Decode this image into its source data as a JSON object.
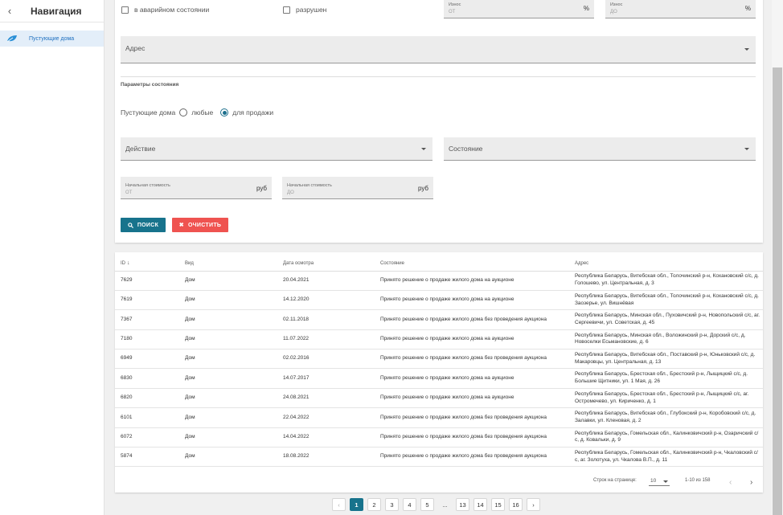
{
  "sidebar": {
    "title": "Навигация",
    "back_icon": "chevron-left-icon",
    "items": [
      {
        "label": "Пустующие дома",
        "icon": "leaf-icon"
      }
    ]
  },
  "filters": {
    "cb_emergency": "в аварийном состоянии",
    "cb_destroyed": "разрушен",
    "wear_from": {
      "label": "Износ",
      "placeholder": "ОТ",
      "suffix": "%"
    },
    "wear_to": {
      "label": "Износ",
      "placeholder": "ДО",
      "suffix": "%"
    },
    "address": "Адрес",
    "section_title": "Параметры состояния",
    "radio_label": "Пустующие дома",
    "radio_any": "любые",
    "radio_sale": "для продажи",
    "radio_selected": "для продажи",
    "action": "Действие",
    "state": "Состояние",
    "price_from": {
      "label": "Начальная стоимость",
      "placeholder": "ОТ",
      "suffix": "руб"
    },
    "price_to": {
      "label": "Начальная стоимость",
      "placeholder": "ДО",
      "suffix": "руб"
    },
    "search_btn": "ПОИСК",
    "clear_btn": "ОЧИСТИТЬ"
  },
  "table": {
    "headers": {
      "id": "ID",
      "kind": "Вид",
      "date": "Дата осмотра",
      "state": "Состояние",
      "address": "Адрес"
    },
    "rows": [
      {
        "id": "7629",
        "kind": "Дом",
        "date": "20.04.2021",
        "state": "Принято решение о продаже жилого дома на аукционе",
        "address": "Республика Беларусь, Витебская обл., Толочинский р-н, Кохановский с/с, д. Голошево, ул. Центральная, д. 3"
      },
      {
        "id": "7619",
        "kind": "Дом",
        "date": "14.12.2020",
        "state": "Принято решение о продаже жилого дома на аукционе",
        "address": "Республика Беларусь, Витебская обл., Толочинский р-н, Кохановский с/с, д. Заозерье, ул. Вишнёвая"
      },
      {
        "id": "7367",
        "kind": "Дом",
        "date": "02.11.2018",
        "state": "Принято решение о продаже жилого дома без проведения аукциона",
        "address": "Республика Беларусь, Минская обл., Пуховичский р-н, Новопольский с/с, аг. Сергеевичи, ул. Советская, д. 45"
      },
      {
        "id": "7180",
        "kind": "Дом",
        "date": "11.07.2022",
        "state": "Принято решение о продаже жилого дома на аукционе",
        "address": "Республика Беларусь, Минская обл., Воложинский р-н, Дорский с/с, д. Новоселки Есьмановские, д. 6"
      },
      {
        "id": "6949",
        "kind": "Дом",
        "date": "02.02.2016",
        "state": "Принято решение о продаже жилого дома без проведения аукциона",
        "address": "Республика Беларусь, Витебская обл., Поставский р-н, Юньковский с/с, д. Макаровцы, ул. Центральная, д. 13"
      },
      {
        "id": "6830",
        "kind": "Дом",
        "date": "14.07.2017",
        "state": "Принято решение о продаже жилого дома на аукционе",
        "address": "Республика Беларусь, Брестская обл., Брестский р-н, Лыщицкий с/с, д. Большие Щитники, ул. 1 Мая, д. 26"
      },
      {
        "id": "6820",
        "kind": "Дом",
        "date": "24.08.2021",
        "state": "Принято решение о продаже жилого дома на аукционе",
        "address": "Республика Беларусь, Брестская обл., Брестский р-н, Лыщицкий с/с, аг. Остромечево, ул. Кириченко, д. 1"
      },
      {
        "id": "6101",
        "kind": "Дом",
        "date": "22.04.2022",
        "state": "Принято решение о продаже жилого дома без проведения аукциона",
        "address": "Республика Беларусь, Витебская обл., Глубокский р-н, Коробовский с/с, д. Залавки, ул. Кленовая, д. 2"
      },
      {
        "id": "6072",
        "kind": "Дом",
        "date": "14.04.2022",
        "state": "Принято решение о продаже жилого дома без проведения аукциона",
        "address": "Республика Беларусь, Гомельская обл., Калинковичский р-н, Озаричский с/с, д. Ковальки, д. 9"
      },
      {
        "id": "5874",
        "kind": "Дом",
        "date": "18.08.2022",
        "state": "Принято решение о продаже жилого дома без проведения аукциона",
        "address": "Республика Беларусь, Гомельская обл., Калинковичский р-н, Чкаловский с/с, аг. Золотуха, ул. Чкалова В.П., д. 11"
      }
    ],
    "footer": {
      "rows_per_page_label": "Строк на странице:",
      "rows_per_page": "10",
      "range": "1-10 из 158"
    }
  },
  "pagination": [
    "1",
    "2",
    "3",
    "4",
    "5",
    "...",
    "13",
    "14",
    "15",
    "16"
  ],
  "pagination_active": "1",
  "colors": {
    "accent": "#17738c",
    "danger": "#ef5350",
    "link": "#1e6fbf"
  }
}
